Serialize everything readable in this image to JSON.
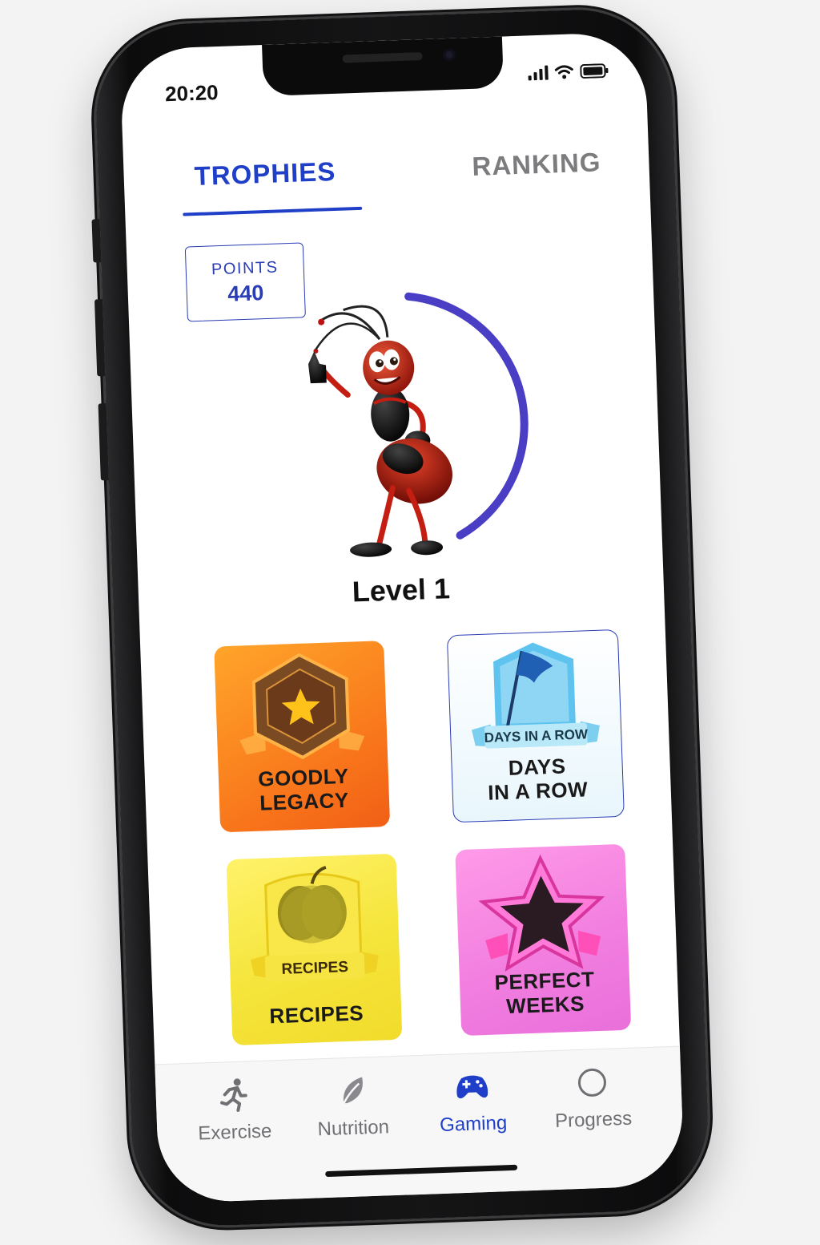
{
  "status": {
    "time": "20:20"
  },
  "tabs": [
    {
      "label": "TROPHIES",
      "active": true
    },
    {
      "label": "RANKING",
      "active": false
    }
  ],
  "points": {
    "label": "POINTS",
    "value": "440"
  },
  "level": {
    "label": "Level 1",
    "progress": 0.42
  },
  "trophies": [
    {
      "title_line1": "GOODLY",
      "title_line2": "LEGACY",
      "icon": "hexagon-star-badge-icon",
      "color": "#f8731a"
    },
    {
      "title_line1": "DAYS",
      "title_line2": "IN A ROW",
      "ribbon": "DAYS IN A ROW",
      "icon": "flag-badge-icon",
      "color": "#4fb3e6"
    },
    {
      "title_line1": "RECIPES",
      "title_line2": "",
      "ribbon": "RECIPES",
      "icon": "apple-badge-icon",
      "color": "#f1dc2b"
    },
    {
      "title_line1": "PERFECT",
      "title_line2": "WEEKS",
      "icon": "star-badge-icon",
      "color": "#e96fda"
    }
  ],
  "nav": [
    {
      "label": "Exercise",
      "icon": "runner-icon",
      "active": false
    },
    {
      "label": "Nutrition",
      "icon": "leaf-icon",
      "active": false
    },
    {
      "label": "Gaming",
      "icon": "gamepad-icon",
      "active": true
    },
    {
      "label": "Progress",
      "icon": "circle-icon",
      "active": false
    }
  ],
  "colors": {
    "accent": "#1f3fc8",
    "arc": "#4a3fc4"
  }
}
